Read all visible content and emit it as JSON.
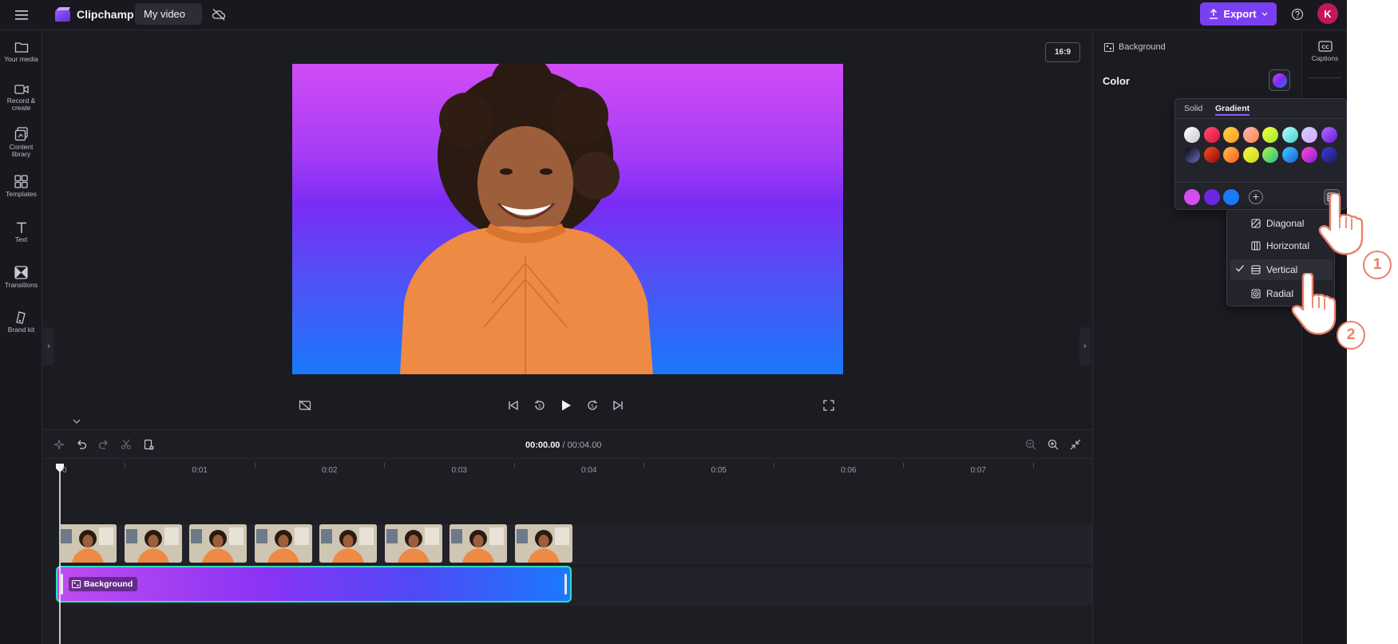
{
  "topbar": {
    "app_name": "Clipchamp",
    "project_name": "My video",
    "export_label": "Export",
    "avatar_initial": "K"
  },
  "sidebar": {
    "items": [
      {
        "label": "Your media",
        "icon": "folder-icon"
      },
      {
        "label": "Record & create",
        "icon": "camera-icon"
      },
      {
        "label": "Content library",
        "icon": "library-icon"
      },
      {
        "label": "Templates",
        "icon": "templates-icon"
      },
      {
        "label": "Text",
        "icon": "text-icon"
      },
      {
        "label": "Transitions",
        "icon": "transitions-icon"
      },
      {
        "label": "Brand kit",
        "icon": "brand-kit-icon"
      }
    ]
  },
  "preview": {
    "aspect_ratio": "16:9"
  },
  "timeline": {
    "current_time": "00:00.00",
    "separator": " / ",
    "total_time": "00:04.00",
    "ruler_ticks": [
      "0",
      "0:01",
      "0:02",
      "0:03",
      "0:04",
      "0:05",
      "0:06",
      "0:07"
    ],
    "background_clip_label": "Background"
  },
  "panel": {
    "title": "Background",
    "color_label": "Color"
  },
  "right_rail": {
    "captions_label": "Captions"
  },
  "color_popover": {
    "tabs": [
      "Solid",
      "Gradient"
    ],
    "active_tab": "Gradient",
    "gradient_presets_row1": [
      [
        "#ffffff",
        "#c9c9cf"
      ],
      [
        "#ff4d6d",
        "#e0103a"
      ],
      [
        "#ffd24a",
        "#ff9a1f"
      ],
      [
        "#ffb3c6",
        "#ff8a3d"
      ],
      [
        "#f4ff4a",
        "#9ee62a"
      ],
      [
        "#bff7ff",
        "#3dd6c4"
      ],
      [
        "#c8d4ff",
        "#e0a3ff"
      ],
      [
        "#b06bff",
        "#6a1bd6"
      ]
    ],
    "gradient_presets_row2": [
      [
        "#000000",
        "#6e6ec8"
      ],
      [
        "#ff4d1f",
        "#8a0a0a"
      ],
      [
        "#ffc24a",
        "#ff5a1f"
      ],
      [
        "#fff44a",
        "#c7d81a"
      ],
      [
        "#b6f24a",
        "#1fbf8a"
      ],
      [
        "#3ad0ff",
        "#1f5bd6"
      ],
      [
        "#ff4dd2",
        "#8a1bd6"
      ],
      [
        "#3d3dd6",
        "#1a1a6a"
      ]
    ],
    "gradient_stops": [
      "#d44df0",
      "#6a26e0",
      "#1a7afc"
    ]
  },
  "direction_menu": {
    "items": [
      {
        "label": "Diagonal",
        "icon": "diagonal-gradient-icon",
        "checked": false
      },
      {
        "label": "Horizontal",
        "icon": "horizontal-gradient-icon",
        "checked": false
      },
      {
        "label": "Vertical",
        "icon": "vertical-gradient-icon",
        "checked": true
      },
      {
        "label": "Radial",
        "icon": "radial-gradient-icon",
        "checked": false
      }
    ]
  },
  "annotations": {
    "step_1": "1",
    "step_2": "2"
  },
  "colors": {
    "accent": "#7b3ff2",
    "clip_border": "#2fe1b9",
    "annotation": "#e8816a"
  }
}
